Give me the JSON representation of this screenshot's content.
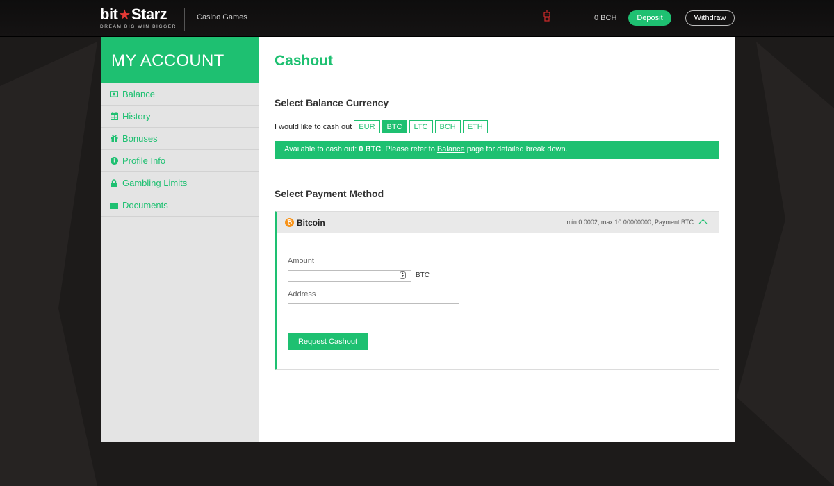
{
  "header": {
    "logo_text_left": "bit",
    "logo_text_right": "Starz",
    "logo_tagline": "DREAM BIG  WIN BIGGER",
    "nav_link": "Casino Games",
    "balance": "0 BCH",
    "deposit_label": "Deposit",
    "withdraw_label": "Withdraw"
  },
  "sidebar": {
    "title": "MY ACCOUNT",
    "items": [
      {
        "label": "Balance",
        "icon": "money-icon"
      },
      {
        "label": "History",
        "icon": "calendar-icon"
      },
      {
        "label": "Bonuses",
        "icon": "gift-icon"
      },
      {
        "label": "Profile Info",
        "icon": "info-icon"
      },
      {
        "label": "Gambling Limits",
        "icon": "lock-icon"
      },
      {
        "label": "Documents",
        "icon": "folder-icon"
      }
    ]
  },
  "main": {
    "title": "Cashout",
    "currency_section_title": "Select Balance Currency",
    "currency_lead": "I would like to cash out",
    "currencies": [
      "EUR",
      "BTC",
      "LTC",
      "BCH",
      "ETH"
    ],
    "selected_currency": "BTC",
    "notice": {
      "prefix": "Available to cash out: ",
      "amount": "0 BTC",
      "middle": ". Please refer to ",
      "link": "Balance",
      "suffix": " page for detailed break down."
    },
    "payment_section_title": "Select Payment Method",
    "method": {
      "name": "Bitcoin",
      "limits": "min 0.0002, max 10.00000000, Payment BTC",
      "amount_label": "Amount",
      "amount_value": "",
      "amount_unit": "BTC",
      "address_label": "Address",
      "address_value": "",
      "submit_label": "Request Cashout"
    }
  },
  "colors": {
    "accent": "#1ec071",
    "bitcoin": "#f7931a",
    "background": "#1d1b1a"
  }
}
